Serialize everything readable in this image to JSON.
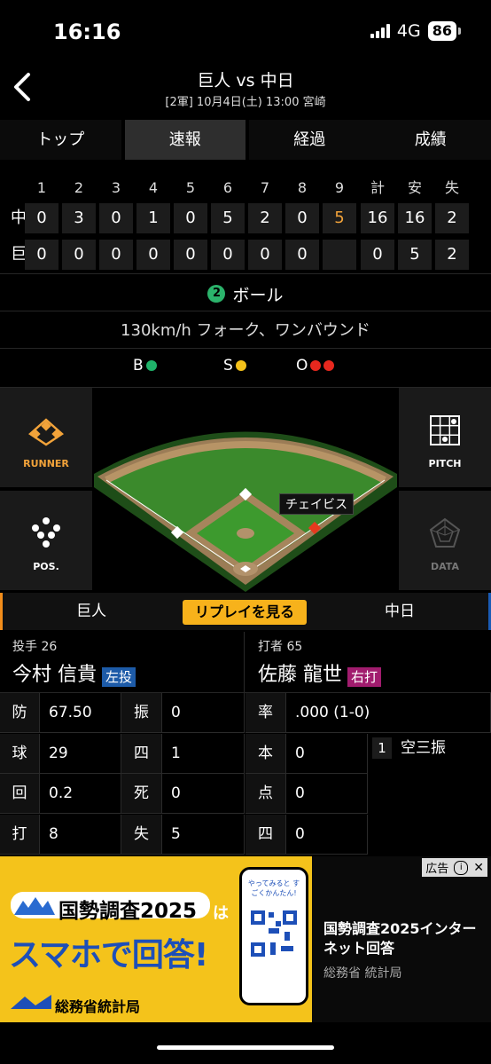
{
  "status": {
    "time": "16:16",
    "network": "4G",
    "battery": "86"
  },
  "header": {
    "title": "巨人 vs 中日",
    "subtitle": "[2軍] 10月4日(土) 13:00 宮崎"
  },
  "tabs": [
    "トップ",
    "速報",
    "経過",
    "成績"
  ],
  "scoreboard": {
    "headers": [
      "1",
      "2",
      "3",
      "4",
      "5",
      "6",
      "7",
      "8",
      "9",
      "計",
      "安",
      "失"
    ],
    "rows": [
      {
        "team": "中",
        "cells": [
          "0",
          "3",
          "0",
          "1",
          "0",
          "5",
          "2",
          "0",
          "5",
          "16",
          "16",
          "2"
        ]
      },
      {
        "team": "巨",
        "cells": [
          "0",
          "0",
          "0",
          "0",
          "0",
          "0",
          "0",
          "0",
          "",
          "0",
          "5",
          "2"
        ]
      }
    ]
  },
  "count": {
    "ball_number": "2",
    "result": "ボール",
    "pitch": "130km/h フォーク、ワンバウンド",
    "b_label": "B",
    "s_label": "S",
    "o_label": "O"
  },
  "colors": {
    "ball": "#1fb36a",
    "strike": "#f5c21a",
    "out": "#e8281e",
    "accent": "#f2a33a"
  },
  "field": {
    "runner_label": "RUNNER",
    "pitch_label": "PITCH",
    "pos_label": "POS.",
    "data_label": "DATA",
    "fielder_tag": "チェイビス"
  },
  "teambar": {
    "left": "巨人",
    "replay": "リプレイを見る",
    "right": "中日"
  },
  "pitcher": {
    "role": "投手 26",
    "name": "今村 信貴",
    "badge": "左投"
  },
  "batter": {
    "role": "打者 65",
    "name": "佐藤 龍世",
    "badge": "右打"
  },
  "pitcher_stats": [
    {
      "k1": "防",
      "v1": "67.50",
      "k2": "振",
      "v2": "0"
    },
    {
      "k1": "球",
      "v1": "29",
      "k2": "四",
      "v2": "1"
    },
    {
      "k1": "回",
      "v1": "0.2",
      "k2": "死",
      "v2": "0"
    },
    {
      "k1": "打",
      "v1": "8",
      "k2": "失",
      "v2": "5"
    }
  ],
  "batter_stats": [
    {
      "k": "率",
      "v": ".000 (1-0)"
    },
    {
      "k": "本",
      "v": "0"
    },
    {
      "k": "点",
      "v": "0"
    },
    {
      "k": "四",
      "v": "0"
    }
  ],
  "at_bat": {
    "num": "1",
    "result": "空三振"
  },
  "ad": {
    "label": "広告",
    "banner_title": "国勢調査2025",
    "banner_ha": "は",
    "banner_main": "スマホで回答!",
    "banner_org": "総務省統計局",
    "phone_text": "やってみると すごくかんたん!",
    "headline": "国勢調査2025インターネット回答",
    "sponsor": "総務省 統計局"
  }
}
